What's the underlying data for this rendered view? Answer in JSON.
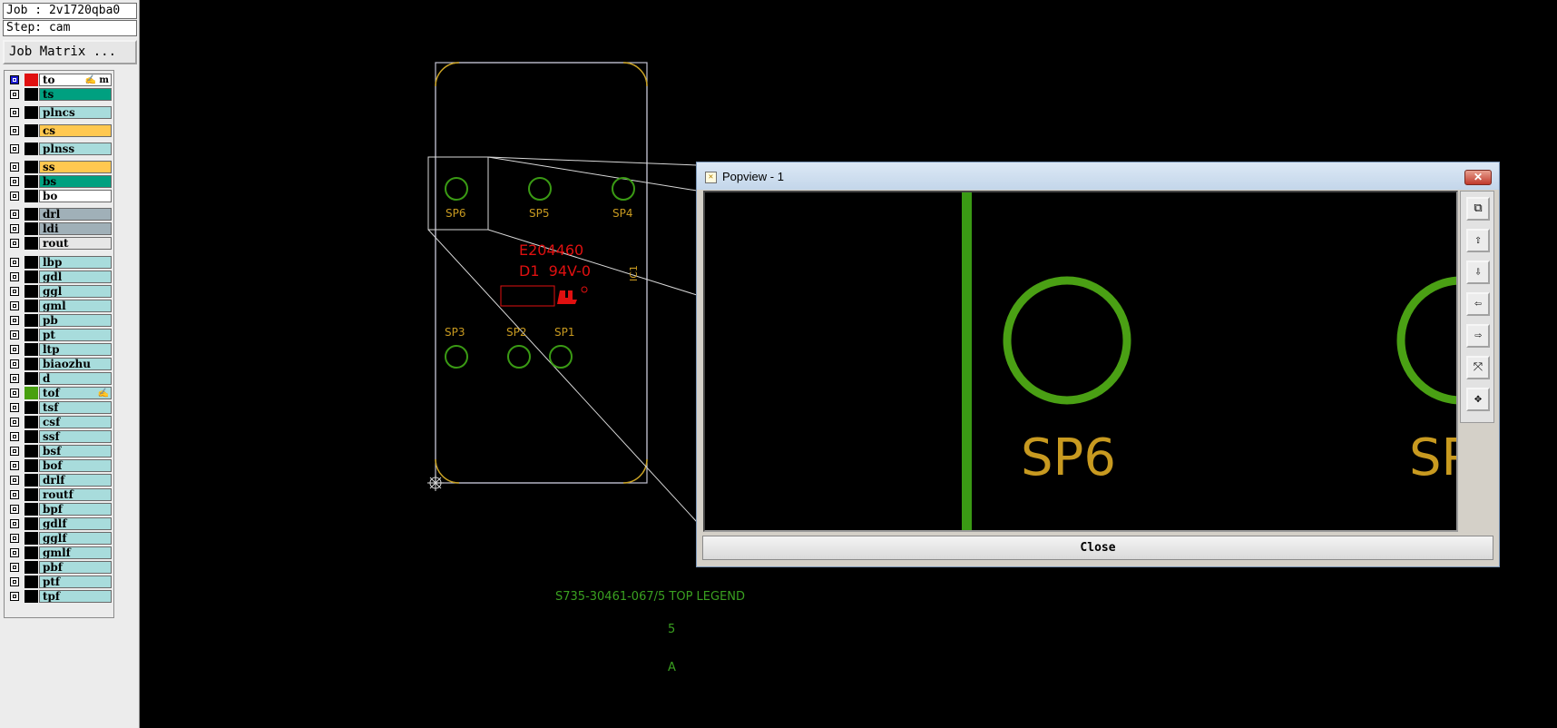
{
  "job": {
    "label": "Job : 2v1720qba0"
  },
  "step": {
    "label": "Step: cam"
  },
  "job_matrix_label": "Job Matrix ...",
  "layers": [
    {
      "name": "to",
      "color": "#ffffff",
      "swatch": "#e01010",
      "checkbox": "blue",
      "mark": "✍ m"
    },
    {
      "name": "ts",
      "color": "#00a080",
      "swatch": "#000000"
    },
    {
      "name": "plncs",
      "color": "#a8dcdc",
      "swatch": "#000000"
    },
    {
      "name": "cs",
      "color": "#ffc850",
      "swatch": "#000000"
    },
    {
      "name": "plnss",
      "color": "#a8dcdc",
      "swatch": "#000000"
    },
    {
      "name": "ss",
      "color": "#ffc850",
      "swatch": "#000000"
    },
    {
      "name": "bs",
      "color": "#00a080",
      "swatch": "#000000"
    },
    {
      "name": "bo",
      "color": "#ffffff",
      "swatch": "#000000"
    },
    {
      "name": "drl",
      "color": "#a0b0b8",
      "swatch": "#000000"
    },
    {
      "name": "ldi",
      "color": "#a0b0b8",
      "swatch": "#000000"
    },
    {
      "name": "rout",
      "color": "#e6e6e6",
      "swatch": "#000000"
    },
    {
      "name": "lbp",
      "color": "#a8dcdc",
      "swatch": "#000000"
    },
    {
      "name": "gdl",
      "color": "#a8dcdc",
      "swatch": "#000000"
    },
    {
      "name": "ggl",
      "color": "#a8dcdc",
      "swatch": "#000000"
    },
    {
      "name": "gml",
      "color": "#a8dcdc",
      "swatch": "#000000"
    },
    {
      "name": "pb",
      "color": "#a8dcdc",
      "swatch": "#000000"
    },
    {
      "name": "pt",
      "color": "#a8dcdc",
      "swatch": "#000000"
    },
    {
      "name": "ltp",
      "color": "#a8dcdc",
      "swatch": "#000000"
    },
    {
      "name": "biaozhu",
      "color": "#a8dcdc",
      "swatch": "#000000"
    },
    {
      "name": "d",
      "color": "#a8dcdc",
      "swatch": "#000000"
    },
    {
      "name": "tof",
      "color": "#a8dcdc",
      "swatch": "#48a010",
      "mark": "✍"
    },
    {
      "name": "tsf",
      "color": "#a8dcdc",
      "swatch": "#000000"
    },
    {
      "name": "csf",
      "color": "#a8dcdc",
      "swatch": "#000000"
    },
    {
      "name": "ssf",
      "color": "#a8dcdc",
      "swatch": "#000000"
    },
    {
      "name": "bsf",
      "color": "#a8dcdc",
      "swatch": "#000000"
    },
    {
      "name": "bof",
      "color": "#a8dcdc",
      "swatch": "#000000"
    },
    {
      "name": "drlf",
      "color": "#a8dcdc",
      "swatch": "#000000"
    },
    {
      "name": "routf",
      "color": "#a8dcdc",
      "swatch": "#000000"
    },
    {
      "name": "bpf",
      "color": "#a8dcdc",
      "swatch": "#000000"
    },
    {
      "name": "gdlf",
      "color": "#a8dcdc",
      "swatch": "#000000"
    },
    {
      "name": "gglf",
      "color": "#a8dcdc",
      "swatch": "#000000"
    },
    {
      "name": "gmlf",
      "color": "#a8dcdc",
      "swatch": "#000000"
    },
    {
      "name": "pbf",
      "color": "#a8dcdc",
      "swatch": "#000000"
    },
    {
      "name": "ptf",
      "color": "#a8dcdc",
      "swatch": "#000000"
    },
    {
      "name": "tpf",
      "color": "#a8dcdc",
      "swatch": "#000000"
    }
  ],
  "board": {
    "pads_top": [
      "SP6",
      "SP5",
      "SP4"
    ],
    "pads_bottom": [
      "SP3",
      "SP2",
      "SP1"
    ],
    "marking_line1": "E204460",
    "marking_line2": "D1  94V-0",
    "ref": "IC1",
    "legend_title": "S735-30461-067/5 TOP LEGEND",
    "legend_rev": "5",
    "legend_letter": "A"
  },
  "colors": {
    "pad_green": "#3a9a14",
    "label_gold": "#c89a20",
    "marking_red": "#e01010",
    "legend_green": "#3aa020",
    "outline_grey": "#c0c0d0"
  },
  "popview": {
    "title": "Popview - 1",
    "close_x": "✕",
    "zoom_label_1": "SP6",
    "zoom_label_2": "SP",
    "close_label": "Close",
    "tools": [
      "zoom-window-icon",
      "page-up-icon",
      "page-down-icon",
      "pan-left-icon",
      "pan-right-icon",
      "zoom-out-icon",
      "zoom-fit-icon"
    ]
  }
}
